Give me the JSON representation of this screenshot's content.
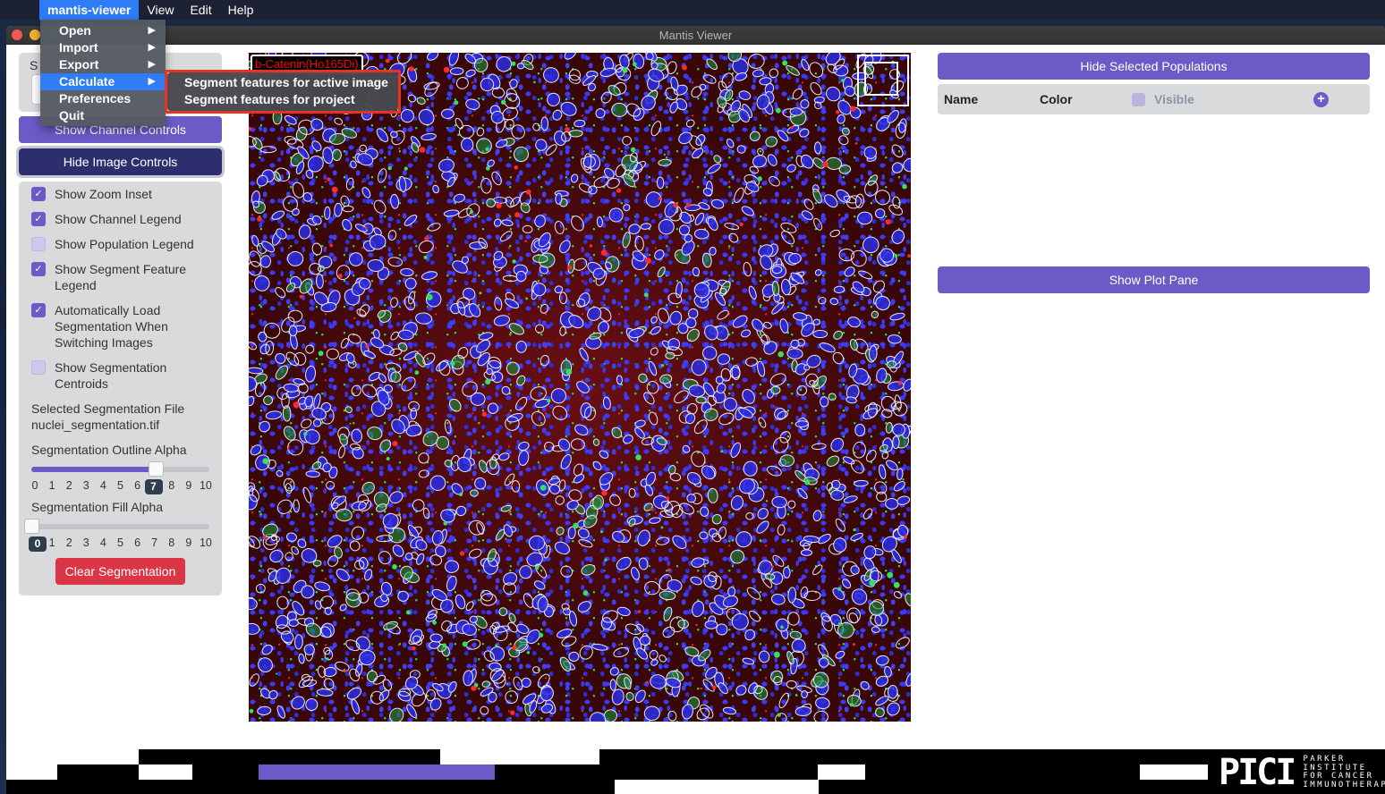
{
  "menubar": {
    "app_name": "mantis-viewer",
    "items": [
      "View",
      "Edit",
      "Help"
    ]
  },
  "app_menu": {
    "items": [
      {
        "label": "Open",
        "has_submenu": true
      },
      {
        "label": "Import",
        "has_submenu": true
      },
      {
        "label": "Export",
        "has_submenu": true
      },
      {
        "label": "Calculate",
        "has_submenu": true,
        "selected": true
      },
      {
        "label": "Preferences",
        "has_submenu": false
      },
      {
        "label": "Quit",
        "has_submenu": false
      }
    ],
    "submenu_arrow": "▶",
    "calculate_submenu": [
      "Segment features for active image",
      "Segment features for project"
    ]
  },
  "window": {
    "title": "Mantis Viewer"
  },
  "left_panel": {
    "image_select_label": "S",
    "show_channel_controls": "Show Channel Controls",
    "hide_image_controls": "Hide Image Controls",
    "options": [
      {
        "label": "Show Zoom Inset",
        "checked": true
      },
      {
        "label": "Show Channel Legend",
        "checked": true
      },
      {
        "label": "Show Population Legend",
        "checked": false
      },
      {
        "label": "Show Segment Feature Legend",
        "checked": true
      },
      {
        "label": "Automatically Load Segmentation When Switching Images",
        "checked": true
      },
      {
        "label": "Show Segmentation Centroids",
        "checked": false
      }
    ],
    "selected_segmentation_label": "Selected Segmentation File",
    "selected_segmentation_file": "nuclei_segmentation.tif",
    "outline_alpha": {
      "label": "Segmentation Outline Alpha",
      "value": 7,
      "min": 0,
      "max": 10,
      "value_label": "7",
      "ticks": [
        "0",
        "1",
        "2",
        "3",
        "4",
        "5",
        "6",
        "7",
        "8",
        "9",
        "10"
      ]
    },
    "fill_alpha": {
      "label": "Segmentation Fill Alpha",
      "value": 0,
      "min": 0,
      "max": 10,
      "value_label": "0",
      "ticks": [
        "0",
        "1",
        "2",
        "3",
        "4",
        "5",
        "6",
        "7",
        "8",
        "9",
        "10"
      ]
    },
    "clear_segmentation": "Clear Segmentation"
  },
  "image": {
    "channel_legend": "b-Catenin(Ho165Di)",
    "channel_legend_color": "#ff0000"
  },
  "right_panel": {
    "hide_selected_populations": "Hide Selected Populations",
    "table_headers": {
      "name": "Name",
      "color": "Color",
      "visible": "Visible"
    },
    "add_icon": "+",
    "show_plot_pane": "Show Plot Pane"
  },
  "footer": {
    "logo_mark": "PICI",
    "logo_text": [
      "PARKER",
      "INSTITUTE",
      "FOR CANCER",
      "IMMUNOTHERAPY"
    ]
  },
  "colors": {
    "accent": "#6a5bc6",
    "dark_button": "#2d2e6e",
    "danger": "#dc3545",
    "menu_highlight": "#2e7cf6",
    "callout_border": "#e8341c"
  }
}
